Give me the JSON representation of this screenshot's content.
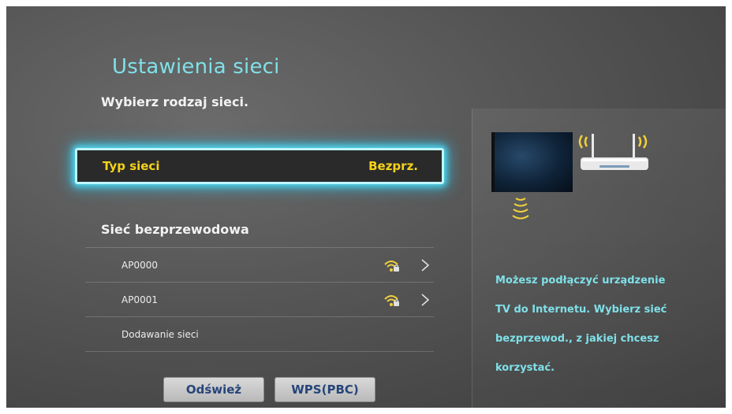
{
  "page": {
    "title": "Ustawienia sieci",
    "subtitle": "Wybierz rodzaj sieci."
  },
  "network_type": {
    "label": "Typ sieci",
    "value": "Bezprz."
  },
  "wireless": {
    "section_title": "Sieć bezprzewodowa",
    "items": [
      {
        "label": "AP0000",
        "icon": "wifi-signal-icon",
        "has_arrow": true
      },
      {
        "label": "AP0001",
        "icon": "wifi-signal-icon",
        "has_arrow": true
      },
      {
        "label": "Dodawanie sieci",
        "icon": "",
        "has_arrow": false
      }
    ]
  },
  "buttons": {
    "refresh": "Odśwież",
    "wps": "WPS(PBC)"
  },
  "info": {
    "lines": [
      "Możesz podłączyć urządzenie",
      "TV do Internetu. Wybierz sieć",
      "bezprzewod., z jakiej chcesz",
      "korzystać."
    ]
  },
  "colors": {
    "title_accent": "#7fe0e8",
    "highlight_text": "#f5d21a",
    "focus_glow": "#4fd8f0",
    "button_text": "#26457a"
  }
}
